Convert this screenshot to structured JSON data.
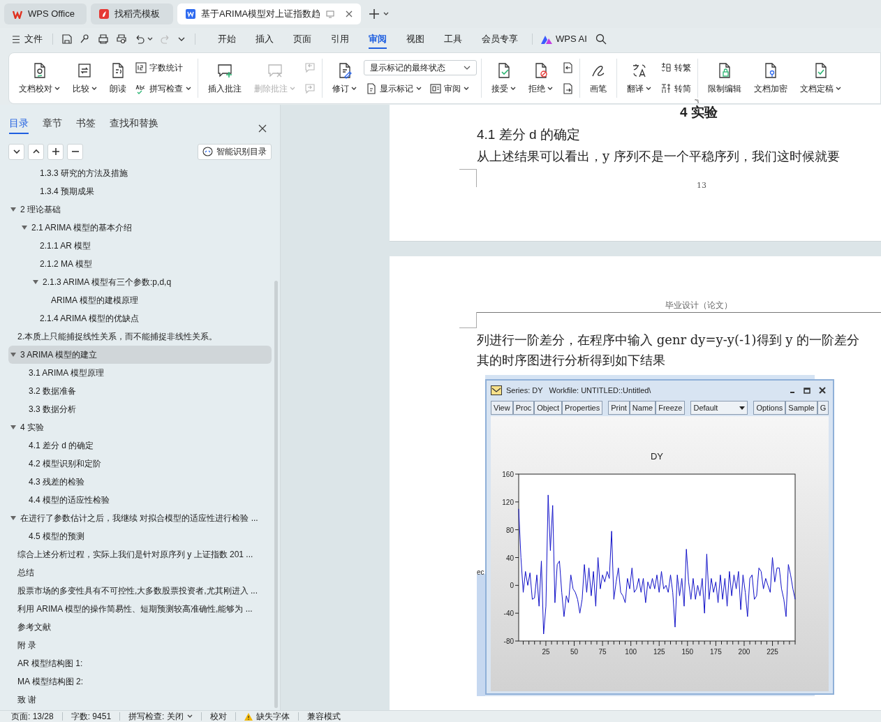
{
  "app_tabs": [
    {
      "label": "WPS Office",
      "kind": "home",
      "selected": false
    },
    {
      "label": "找稻壳模板",
      "kind": "template",
      "selected": false
    },
    {
      "label": "基于ARIMA模型对上证指数趋",
      "kind": "doc",
      "selected": true
    }
  ],
  "menu": {
    "file": "文件",
    "quick_access": [
      {
        "disabled": false,
        "dropdown": false
      },
      {
        "disabled": false,
        "dropdown": false
      },
      {
        "disabled": false,
        "dropdown": false
      },
      {
        "disabled": false,
        "dropdown": false
      },
      {
        "disabled": false,
        "dropdown": true
      },
      {
        "disabled": true,
        "dropdown": false
      }
    ],
    "tabs": [
      {
        "label": "开始",
        "selected": false
      },
      {
        "label": "插入",
        "selected": false
      },
      {
        "label": "页面",
        "selected": false
      },
      {
        "label": "引用",
        "selected": false
      },
      {
        "label": "审阅",
        "selected": true
      },
      {
        "label": "视图",
        "selected": false
      },
      {
        "label": "工具",
        "selected": false
      },
      {
        "label": "会员专享",
        "selected": false
      }
    ],
    "ai": "WPS AI"
  },
  "ribbon": [
    {
      "items": [
        {
          "kind": "large",
          "label": "文档校对",
          "dropdown": true,
          "disabled": false
        },
        {
          "kind": "large",
          "label": "比较",
          "dropdown": true,
          "disabled": false
        },
        {
          "kind": "large",
          "label": "朗读",
          "dropdown": false,
          "disabled": false
        },
        {
          "kind": "stack",
          "rows": [
            [
              {
                "kind": "small",
                "label": "字数统计",
                "dropdown": false,
                "disabled": false
              }
            ],
            [
              {
                "kind": "small",
                "label": "拼写检查",
                "dropdown": true,
                "disabled": false
              }
            ]
          ]
        }
      ]
    },
    {
      "items": [
        {
          "kind": "large",
          "label": "插入批注",
          "dropdown": false,
          "disabled": false
        },
        {
          "kind": "large",
          "label": "删除批注",
          "dropdown": true,
          "disabled": true
        },
        {
          "kind": "stack",
          "rows": [
            [
              {
                "kind": "icon",
                "disabled": true
              }
            ],
            [
              {
                "kind": "icon",
                "disabled": true
              }
            ]
          ]
        }
      ]
    },
    {
      "items": [
        {
          "kind": "large",
          "label": "修订",
          "dropdown": true,
          "disabled": false
        },
        {
          "kind": "stack",
          "rows": [
            [
              {
                "kind": "select",
                "value": "显示标记的最终状态"
              }
            ],
            [
              {
                "kind": "small",
                "label": "显示标记",
                "dropdown": true,
                "disabled": false
              },
              {
                "kind": "small",
                "label": "审阅",
                "dropdown": true,
                "disabled": false
              }
            ]
          ]
        }
      ]
    },
    {
      "items": [
        {
          "kind": "large",
          "label": "接受",
          "dropdown": true,
          "disabled": false
        },
        {
          "kind": "large",
          "label": "拒绝",
          "dropdown": true,
          "disabled": false
        },
        {
          "kind": "stack",
          "rows": [
            [
              {
                "kind": "icon",
                "disabled": false
              }
            ],
            [
              {
                "kind": "icon",
                "disabled": false
              }
            ]
          ]
        }
      ]
    },
    {
      "items": [
        {
          "kind": "large",
          "label": "画笔",
          "dropdown": false,
          "disabled": false
        }
      ]
    },
    {
      "items": [
        {
          "kind": "large",
          "label": "翻译",
          "dropdown": true,
          "disabled": false
        },
        {
          "kind": "stack",
          "rows": [
            [
              {
                "kind": "small",
                "label": "转繁",
                "dropdown": false,
                "disabled": false
              }
            ],
            [
              {
                "kind": "small",
                "label": "转简",
                "dropdown": false,
                "disabled": false
              }
            ]
          ]
        }
      ]
    },
    {
      "items": [
        {
          "kind": "large",
          "label": "限制编辑",
          "dropdown": false,
          "disabled": false
        },
        {
          "kind": "large",
          "label": "文档加密",
          "dropdown": false,
          "disabled": false
        },
        {
          "kind": "large",
          "label": "文档定稿",
          "dropdown": true,
          "disabled": false
        }
      ]
    }
  ],
  "sidebar": {
    "tabs": [
      {
        "label": "目录",
        "selected": true
      },
      {
        "label": "章节",
        "selected": false
      },
      {
        "label": "书签",
        "selected": false
      },
      {
        "label": "查找和替换",
        "selected": false
      }
    ],
    "smart_button": "智能识别目录",
    "tree": [
      {
        "children": [
          {
            "children": [
              {
                "label": "1.3.3 研究的方法及措施",
                "selected": false
              },
              {
                "label": "1.3.4 预期成果",
                "selected": false
              }
            ]
          }
        ]
      },
      {
        "label": "2  理论基础",
        "selected": false,
        "expanded": true,
        "children": [
          {
            "label": "2.1 ARIMA 模型的基本介绍",
            "selected": false,
            "expanded": true,
            "children": [
              {
                "label": "2.1.1    AR 模型",
                "selected": false
              },
              {
                "label": "2.1.2    MA 模型",
                "selected": false
              },
              {
                "label": "2.1.3 ARIMA 模型有三个参数:p,d,q",
                "selected": false,
                "expanded": true,
                "children": [
                  {
                    "label": "ARIMA 模型的建模原理",
                    "selected": false
                  }
                ]
              },
              {
                "label": "2.1.4 ARIMA 模型的优缺点",
                "selected": false
              }
            ]
          }
        ]
      },
      {
        "label": "2.本质上只能捕捉线性关系，而不能捕捉非线性关系。",
        "selected": false
      },
      {
        "label": "3  ARIMA 模型的建立",
        "selected": true,
        "expanded": true,
        "children": [
          {
            "label": "3.1 ARIMA 模型原理",
            "selected": false
          },
          {
            "label": "3.2  数据准备",
            "selected": false
          },
          {
            "label": "3.3  数据分析",
            "selected": false
          }
        ]
      },
      {
        "label": "4  实验",
        "selected": false,
        "expanded": true,
        "children": [
          {
            "label": "4.1  差分 d 的确定",
            "selected": false
          },
          {
            "label": "4.2 模型识别和定阶",
            "selected": false
          },
          {
            "label": "4.3  残差的检验",
            "selected": false
          },
          {
            "label": "4.4 模型的适应性检验",
            "selected": false
          }
        ]
      },
      {
        "label": "在进行了参数估计之后，我继续 对拟合模型的适应性进行检验 ...",
        "selected": false,
        "expanded": true,
        "children": [
          {
            "label": "4.5 模型的预测",
            "selected": false
          }
        ]
      },
      {
        "label": "综合上述分析过程，实际上我们是针对原序列 y 上证指数 201 ...",
        "selected": false
      },
      {
        "label": "总结",
        "selected": false
      },
      {
        "label": "股票市场的多变性具有不可控性,大多数股票投资者,尤其刚进入 ...",
        "selected": false
      },
      {
        "label": "利用 ARIMA 模型的操作简易性、短期预测较高准确性,能够为 ...",
        "selected": false
      },
      {
        "label": "参考文献",
        "selected": false
      },
      {
        "label": "附  录",
        "selected": false
      },
      {
        "label": "AR 模型结构图 1:",
        "selected": false
      },
      {
        "label": "MA 模型结构图 2:",
        "selected": false
      },
      {
        "label": "致  谢",
        "selected": false
      }
    ]
  },
  "document": {
    "page1": {
      "chapter": "4  实验",
      "heading": "4.1  差分 d 的确定",
      "paragraph": "从上述结果可以看出，y 序列不是一个平稳序列，我们这时候就要",
      "page_number": "13"
    },
    "page2": {
      "header": "毕业设计（论文）",
      "lines": [
        "列进行一阶差分，在程序中输入 genr dy=y-y(-1)得到 y 的一阶差分",
        "其的时序图进行分析得到如下结果"
      ],
      "figure": {
        "background_text": "ec",
        "title": "Series: DY   Workfile: UNTITLED::Untitled\\",
        "toolbar": [
          [
            "View",
            "Proc",
            "Object",
            "Properties"
          ],
          [
            "Print",
            "Name",
            "Freeze"
          ]
        ],
        "select": "Default",
        "toolbar2": [
          "Options",
          "Sample",
          "G"
        ],
        "chart_data": {
          "type": "line",
          "title": "DY",
          "x": [
            1,
            3,
            5,
            7,
            9,
            11,
            13,
            15,
            17,
            19,
            21,
            23,
            25,
            27,
            29,
            31,
            33,
            35,
            37,
            39,
            41,
            43,
            45,
            47,
            49,
            51,
            53,
            55,
            57,
            59,
            61,
            63,
            65,
            67,
            69,
            71,
            73,
            75,
            77,
            79,
            81,
            83,
            85,
            87,
            89,
            91,
            93,
            95,
            97,
            99,
            101,
            103,
            105,
            107,
            109,
            111,
            113,
            115,
            117,
            119,
            121,
            123,
            125,
            127,
            129,
            131,
            133,
            135,
            137,
            139,
            141,
            143,
            145,
            147,
            149,
            151,
            153,
            155,
            157,
            159,
            161,
            163,
            165,
            167,
            169,
            171,
            173,
            175,
            177,
            179,
            181,
            183,
            185,
            187,
            189,
            191,
            193,
            195,
            197,
            199,
            201,
            203,
            205,
            207,
            209,
            211,
            213,
            215,
            217,
            219,
            221,
            223,
            225,
            227,
            229,
            231,
            233,
            235,
            237,
            239,
            241,
            243,
            245
          ],
          "series": [
            {
              "color": "#1010c8",
              "values": [
                110,
                40,
                -10,
                20,
                0,
                18,
                -20,
                -18,
                15,
                -30,
                35,
                -70,
                -30,
                130,
                50,
                115,
                -25,
                30,
                35,
                -10,
                -45,
                -15,
                -25,
                15,
                -5,
                -10,
                -20,
                -40,
                -20,
                30,
                -10,
                25,
                -15,
                20,
                -30,
                40,
                -5,
                15,
                5,
                20,
                10,
                78,
                -20,
                5,
                25,
                -10,
                -15,
                -25,
                10,
                -5,
                25,
                -10,
                -5,
                10,
                -10,
                10,
                -25,
                5,
                -5,
                10,
                -5,
                15,
                -10,
                20,
                -5,
                0,
                -10,
                15,
                -10,
                -60,
                15,
                -15,
                10,
                -30,
                52,
                5,
                -20,
                10,
                -20,
                0,
                -15,
                10,
                -40,
                45,
                -20,
                10,
                -10,
                5,
                -25,
                15,
                -20,
                10,
                -30,
                20,
                -15,
                15,
                -5,
                20,
                -35,
                15,
                -10,
                -45,
                10,
                15,
                -20,
                -15,
                25,
                20,
                -5,
                10,
                0,
                -10,
                40,
                5,
                25,
                25,
                -5,
                -20,
                -45,
                30,
                15,
                -5,
                -20
              ]
            }
          ],
          "xlim": [
            1,
            245
          ],
          "ylim": [
            -80,
            160
          ],
          "xticks": [
            25,
            50,
            75,
            100,
            125,
            150,
            175,
            200,
            225
          ],
          "yticks": [
            -80,
            -40,
            0,
            40,
            80,
            120,
            160
          ]
        }
      }
    }
  },
  "status_bar": [
    "页面: 13/28",
    "字数: 9451",
    {
      "label": "拼写检查: 关闭",
      "dropdown": true
    },
    "校对",
    {
      "label": "缺失字体",
      "warning": true
    },
    "兼容模式"
  ]
}
